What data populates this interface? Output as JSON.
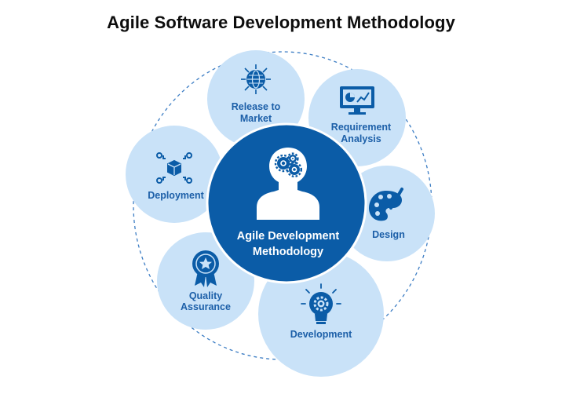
{
  "title": "Agile Software Development Methodology",
  "colors": {
    "primary": "#0b5ca7",
    "circle_fill": "#c9e2f8",
    "label": "#1c5fa8",
    "dashed_ring": "#3c7dc4"
  },
  "center": {
    "line1": "Agile Development",
    "line2": "Methodology",
    "icon": "person-with-gears-icon"
  },
  "stages": [
    {
      "key": "release",
      "line1": "Release to",
      "line2": "Market",
      "icon": "globe-arrows-icon"
    },
    {
      "key": "requirement",
      "line1": "Requirement",
      "line2": "Analysis",
      "icon": "monitor-chart-icon"
    },
    {
      "key": "design",
      "line1": "Design",
      "line2": "",
      "icon": "palette-brush-icon"
    },
    {
      "key": "development",
      "line1": "Development",
      "line2": "",
      "icon": "lightbulb-gear-icon"
    },
    {
      "key": "quality",
      "line1": "Quality",
      "line2": "Assurance",
      "icon": "award-badge-icon"
    },
    {
      "key": "deployment",
      "line1": "Deployment",
      "line2": "",
      "icon": "cube-network-icon"
    }
  ]
}
